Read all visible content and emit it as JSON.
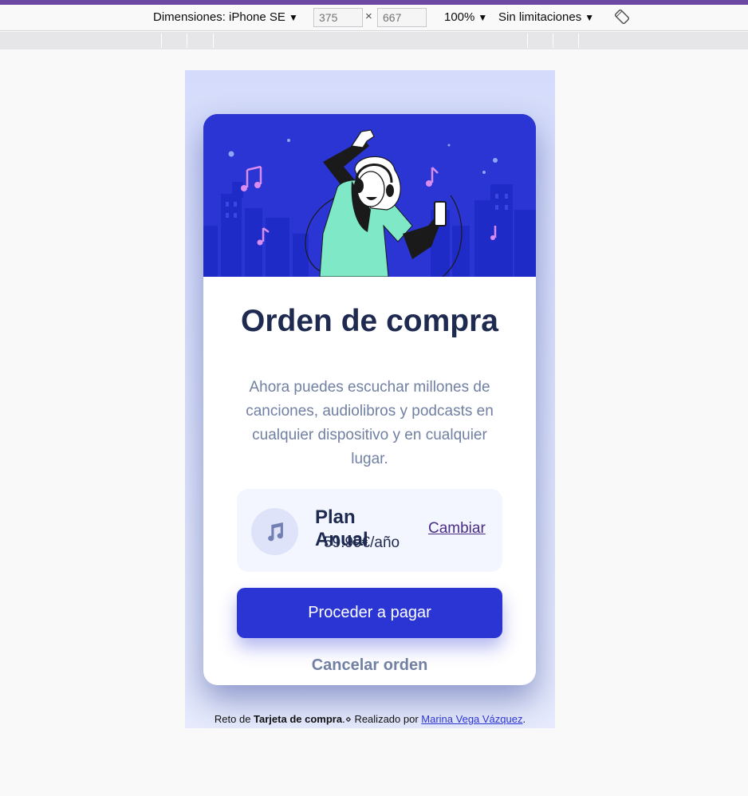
{
  "devtools": {
    "device_label": "Dimensiones: iPhone SE",
    "width": "375",
    "height": "667",
    "times": "×",
    "zoom": "100%",
    "throttle": "Sin limitaciones",
    "accent": "#6b49a3"
  },
  "card": {
    "title": "Orden de compra",
    "description": "Ahora puedes escuchar millones de canciones, audiolibros y podcasts en cualquier dispositivo y en cualquier lugar.",
    "plan": {
      "icon": "music-note-icon",
      "name": "Plan Anual",
      "price": "59.99€/año",
      "change_label": "Cambiar"
    },
    "pay_label": "Proceder a pagar",
    "cancel_label": "Cancelar orden",
    "colors": {
      "primary": "#2a35d4",
      "heading": "#1e2a4f",
      "muted": "#7180a3",
      "plan_bg": "#f4f6ff"
    }
  },
  "attribution": {
    "prefix": "Reto de ",
    "challenge": "Tarjeta de compra",
    "middle": ".⋄ Realizado por ",
    "author": "Marina Vega Vázquez",
    "suffix": "."
  }
}
